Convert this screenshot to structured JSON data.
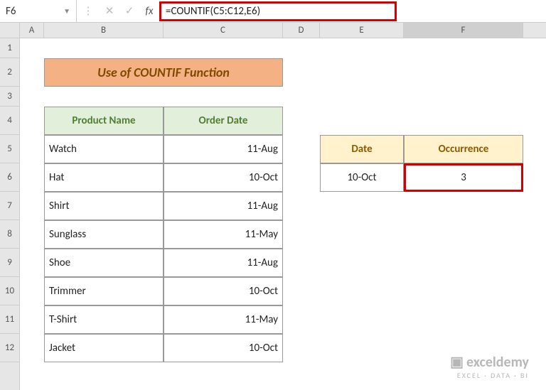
{
  "namebox": "F6",
  "formula": "=COUNTIF(C5:C12,E6)",
  "cols": [
    "A",
    "B",
    "C",
    "D",
    "E",
    "F"
  ],
  "rows": [
    "1",
    "2",
    "3",
    "4",
    "5",
    "6",
    "7",
    "8",
    "9",
    "10",
    "11",
    "12"
  ],
  "banner": "Use of COUNTIF Function",
  "headers": {
    "product": "Product Name",
    "date": "Order Date"
  },
  "table": [
    {
      "p": "Watch",
      "d": "11-Aug"
    },
    {
      "p": "Hat",
      "d": "10-Oct"
    },
    {
      "p": "Shirt",
      "d": "11-Aug"
    },
    {
      "p": "Sunglass",
      "d": "11-May"
    },
    {
      "p": "Shoe",
      "d": "11-Aug"
    },
    {
      "p": "Trimmer",
      "d": "10-Oct"
    },
    {
      "p": "T-Shirt",
      "d": "11-May"
    },
    {
      "p": "Jacket",
      "d": "10-Oct"
    }
  ],
  "side": {
    "h1": "Date",
    "h2": "Occurrence",
    "date": "10-Oct",
    "occ": "3"
  },
  "wm": {
    "brand": "exceldemy",
    "sub": "EXCEL · DATA · BI"
  },
  "chart_data": {
    "type": "table",
    "title": "Use of COUNTIF Function",
    "columns": [
      "Product Name",
      "Order Date"
    ],
    "rows": [
      [
        "Watch",
        "11-Aug"
      ],
      [
        "Hat",
        "10-Oct"
      ],
      [
        "Shirt",
        "11-Aug"
      ],
      [
        "Sunglass",
        "11-May"
      ],
      [
        "Shoe",
        "11-Aug"
      ],
      [
        "Trimmer",
        "10-Oct"
      ],
      [
        "T-Shirt",
        "11-May"
      ],
      [
        "Jacket",
        "10-Oct"
      ]
    ],
    "summary": {
      "Date": "10-Oct",
      "Occurrence": 3
    }
  }
}
